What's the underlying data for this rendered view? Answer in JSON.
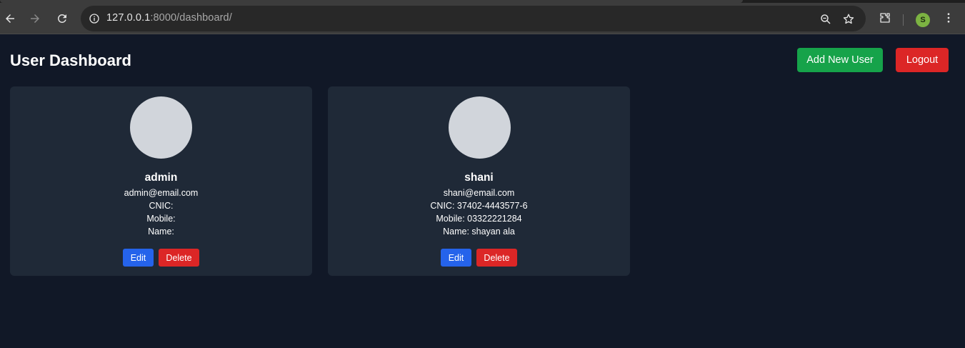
{
  "browser": {
    "url_host": "127.0.0.1",
    "url_rest": ":8000/dashboard/",
    "profile_initial": "S",
    "profile_color": "#7cb342"
  },
  "header": {
    "title": "User Dashboard",
    "add_label": "Add New User",
    "logout_label": "Logout"
  },
  "colors": {
    "background": "#111827",
    "card": "#1f2937",
    "add": "#16a34a",
    "danger": "#dc2626",
    "edit": "#2563eb"
  },
  "users": [
    {
      "username": "admin",
      "email": "admin@email.com",
      "cnic": "CNIC:",
      "mobile": "Mobile:",
      "name": "Name:",
      "edit_label": "Edit",
      "delete_label": "Delete"
    },
    {
      "username": "shani",
      "email": "shani@email.com",
      "cnic": "CNIC: 37402-4443577-6",
      "mobile": "Mobile: 03322221284",
      "name": "Name: shayan ala",
      "edit_label": "Edit",
      "delete_label": "Delete"
    }
  ]
}
